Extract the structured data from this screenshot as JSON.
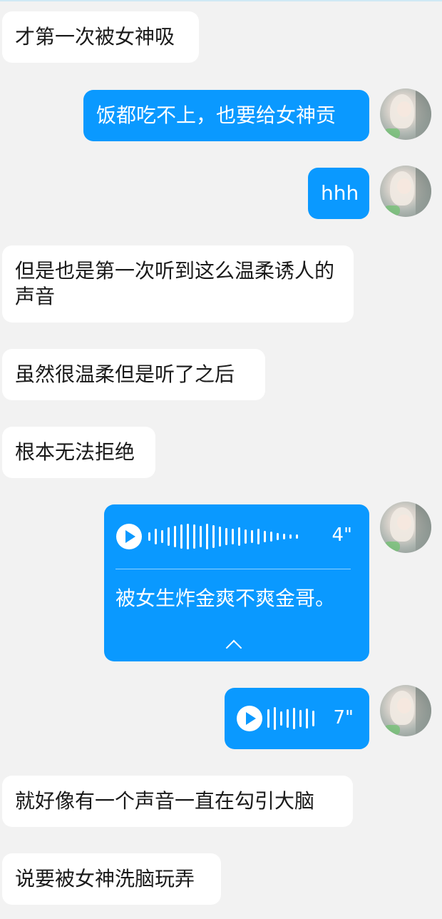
{
  "messages": {
    "m1": "才第一次被女神吸",
    "m2": "饭都吃不上，也要给女神贡",
    "m3": "hhh",
    "m4": "但是也是第一次听到这么温柔诱人的声音",
    "m5": "虽然很温柔但是听了之后",
    "m6": "根本无法拒绝",
    "voice1": {
      "duration": "4\"",
      "transcript": "被女生炸金爽不爽金哥。"
    },
    "voice2": {
      "duration": "7\""
    },
    "m7": "就好像有一个声音一直在勾引大脑",
    "m8": "说要被女神洗脑玩弄"
  },
  "colors": {
    "right_bubble": "#0a99ff",
    "left_bubble": "#ffffff",
    "background": "#f2f2f2"
  },
  "icons": {
    "play": "play-icon",
    "chevron": "chevron-up-icon"
  }
}
